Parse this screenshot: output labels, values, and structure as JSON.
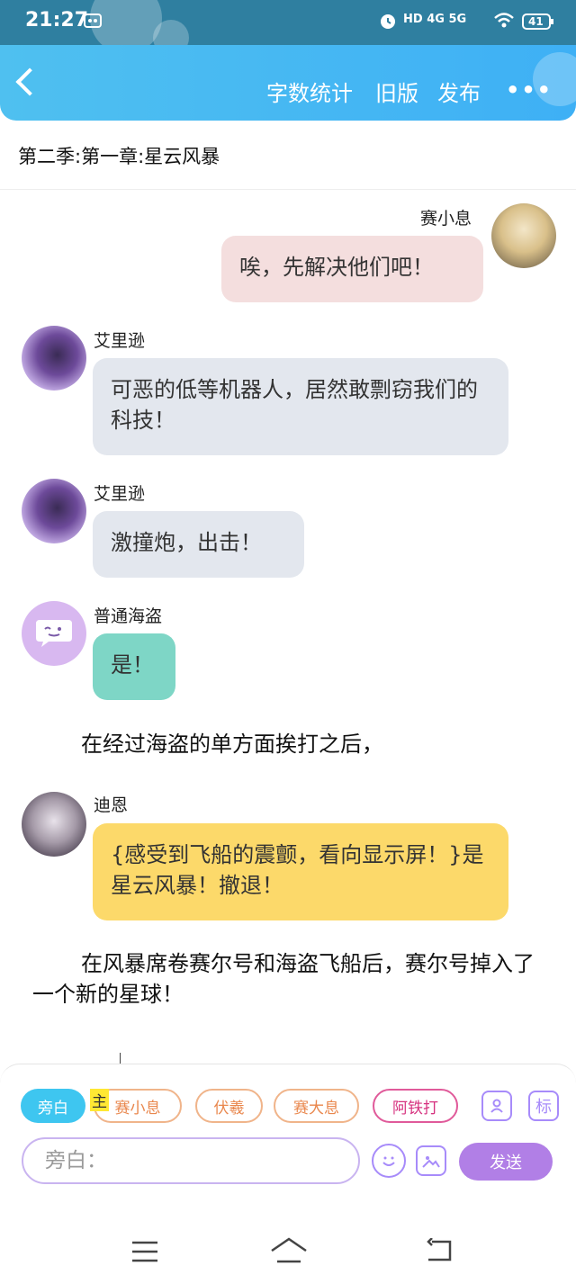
{
  "status_bar": {
    "time": "21:27",
    "network": "HD 4G 5G",
    "battery": "41"
  },
  "header": {
    "back_label": "",
    "word_count": "字数统计",
    "old_version": "旧版",
    "publish": "发布",
    "more": "•••"
  },
  "chapter_title": "第二季:第一章:星云风暴",
  "messages": [
    {
      "type": "right",
      "name": "赛小息",
      "text": "唉，先解决他们吧！",
      "bubble_color": "#f4dede"
    },
    {
      "type": "left",
      "name": "艾里逊",
      "text": "可恶的低等机器人，居然敢剽窃我们的科技！",
      "bubble_color": "#e3e7ee"
    },
    {
      "type": "left",
      "name": "艾里逊",
      "text": "激撞炮，出击！",
      "bubble_color": "#e3e7ee"
    },
    {
      "type": "left",
      "name": "普通海盗",
      "text": "是！",
      "bubble_color": "#7ed6c6"
    },
    {
      "type": "narration",
      "text": "在经过海盗的单方面挨打之后，"
    },
    {
      "type": "left",
      "name": "迪恩",
      "text": "{感受到飞船的震颤，看向显示屏！}是星云风暴！撤退！",
      "bubble_color": "#fcd96a"
    },
    {
      "type": "narration",
      "text": "在风暴席卷赛尔号和海盗飞船后，赛尔号掉入了一个新的星球！"
    }
  ],
  "toolbar": {
    "roles": [
      {
        "label": "旁白",
        "selected": true
      },
      {
        "label": "赛小息",
        "selected": false
      },
      {
        "label": "伏羲",
        "selected": false
      },
      {
        "label": "赛大息",
        "selected": false
      },
      {
        "label": "阿铁打",
        "selected": false
      }
    ],
    "main_tag": "主",
    "input_placeholder": "旁白：",
    "send": "发送",
    "mark_icon": "标"
  },
  "colors": {
    "header": "#42b8f3",
    "accent": "#b17fe6",
    "narrator_chip": "#3ec6f0"
  }
}
